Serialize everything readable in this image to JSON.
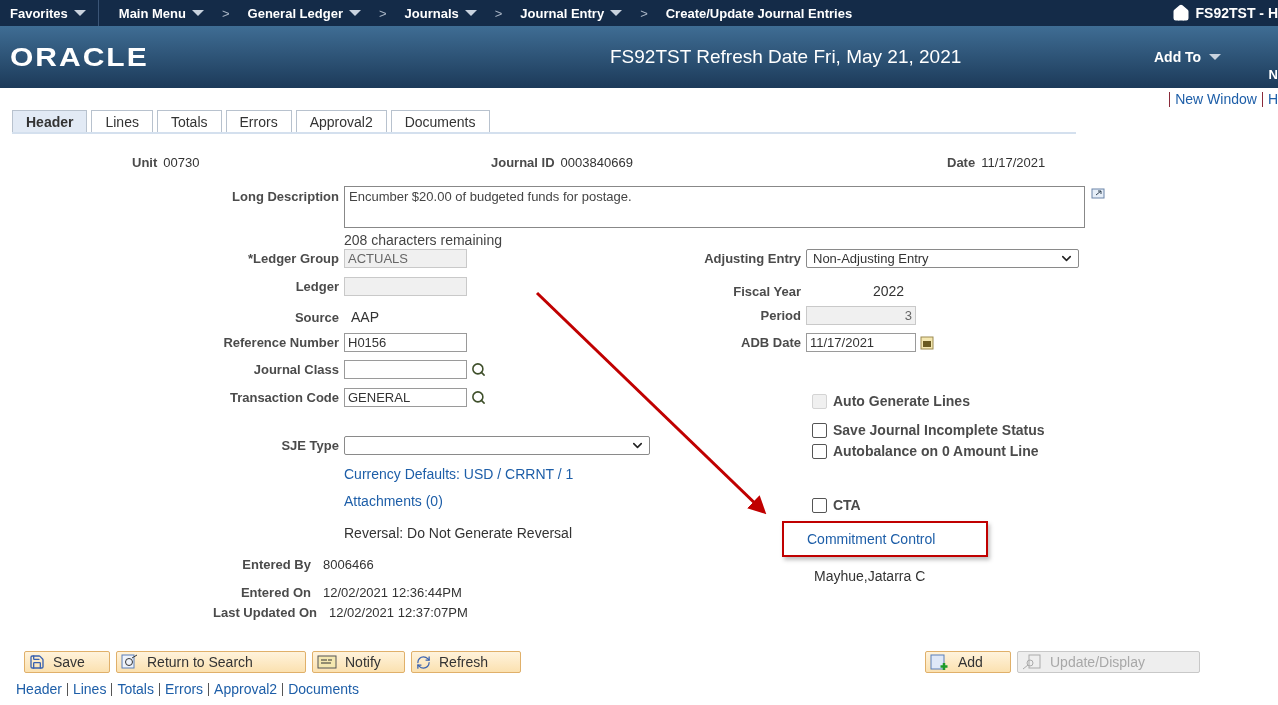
{
  "nav": {
    "items": [
      {
        "kind": "menu",
        "label": "Favorites"
      },
      {
        "kind": "menu",
        "label": "Main Menu"
      },
      {
        "kind": "separator",
        "label": ">"
      },
      {
        "kind": "menu",
        "label": "General Ledger"
      },
      {
        "kind": "separator",
        "label": ">"
      },
      {
        "kind": "menu",
        "label": "Journals"
      },
      {
        "kind": "separator",
        "label": ">"
      },
      {
        "kind": "menu",
        "label": "Journal Entry"
      },
      {
        "kind": "separator",
        "label": ">"
      },
      {
        "kind": "page",
        "label": "Create/Update Journal Entries"
      }
    ],
    "home": "FS92TST - H"
  },
  "banner": {
    "logo": "ORACLE",
    "title": "FS92TST Refresh Date Fri, May 21, 2021",
    "add_to": "Add To",
    "cut_text": "N"
  },
  "page_links": [
    "New Window",
    "H"
  ],
  "tabs": [
    {
      "label": "Header",
      "selected": true
    },
    {
      "label": "Lines",
      "selected": false
    },
    {
      "label": "Totals",
      "selected": false
    },
    {
      "label": "Errors",
      "selected": false
    },
    {
      "label": "Approval2",
      "selected": false
    },
    {
      "label": "Documents",
      "selected": false
    }
  ],
  "summary": [
    {
      "label": "Unit",
      "value": "00730"
    },
    {
      "label": "Journal ID",
      "value": "0003840669"
    },
    {
      "label": "Date",
      "value": "11/17/2021"
    }
  ],
  "long_description": {
    "label": "Long Description",
    "value": "Encumber $20.00 of budgeted funds for postage.",
    "remaining": "208 characters remaining"
  },
  "left_fields": [
    {
      "kind": "input",
      "label": "*Ledger Group",
      "value": "ACTUALS",
      "disabled": true
    },
    {
      "kind": "input",
      "label": "Ledger",
      "disabled": true
    },
    {
      "kind": "text",
      "label": "Source",
      "value": "AAP"
    },
    {
      "kind": "input",
      "label": "Reference Number",
      "value": "H0156",
      "disabled": false
    },
    {
      "kind": "lookup",
      "label": "Journal Class"
    },
    {
      "kind": "lookup",
      "label": "Transaction Code",
      "value": "GENERAL"
    },
    {
      "kind": "select",
      "label": "SJE Type"
    },
    {
      "kind": "link",
      "text": "Currency Defaults: USD / CRRNT / 1"
    },
    {
      "kind": "link",
      "text": "Attachments (0)"
    },
    {
      "kind": "note",
      "text": "Reversal: Do Not Generate Reversal"
    },
    {
      "kind": "audit",
      "label": "Entered By",
      "value": "8006466"
    },
    {
      "kind": "audit",
      "label": "Entered On",
      "value": "12/02/2021 12:36:44PM"
    },
    {
      "kind": "audit",
      "label": "Last Updated On",
      "value": "12/02/2021 12:37:07PM"
    }
  ],
  "right_fields": [
    {
      "kind": "select",
      "label": "Adjusting Entry",
      "value": "Non-Adjusting Entry"
    },
    {
      "kind": "text",
      "label": "Fiscal Year",
      "value": "2022"
    },
    {
      "kind": "input",
      "label": "Period",
      "value": "3",
      "disabled": true
    },
    {
      "kind": "date",
      "label": "ADB Date",
      "value": "11/17/2021"
    },
    {
      "kind": "checkbox",
      "label": "Auto Generate Lines",
      "checked": false,
      "disabled": true
    },
    {
      "kind": "checkbox",
      "label": "Save Journal Incomplete Status",
      "checked": false,
      "disabled": false
    },
    {
      "kind": "checkbox",
      "label": "Autobalance on 0 Amount Line",
      "checked": false,
      "disabled": false
    },
    {
      "kind": "checkbox",
      "label": "CTA",
      "checked": false,
      "disabled": false
    },
    {
      "kind": "link",
      "text": "Commitment Control",
      "highlighted": true
    },
    {
      "kind": "note",
      "text": "Mayhue,Jatarra C"
    }
  ],
  "buttons_left": [
    {
      "kind": "save",
      "label": "Save"
    },
    {
      "kind": "search",
      "label": "Return to Search"
    },
    {
      "kind": "notify",
      "label": "Notify"
    },
    {
      "kind": "refresh",
      "label": "Refresh"
    }
  ],
  "buttons_right": [
    {
      "kind": "add",
      "label": "Add",
      "disabled": false
    },
    {
      "kind": "update",
      "label": "Update/Display",
      "disabled": true
    }
  ],
  "footer_links": [
    "Header",
    "Lines",
    "Totals",
    "Errors",
    "Approval2",
    "Documents"
  ]
}
